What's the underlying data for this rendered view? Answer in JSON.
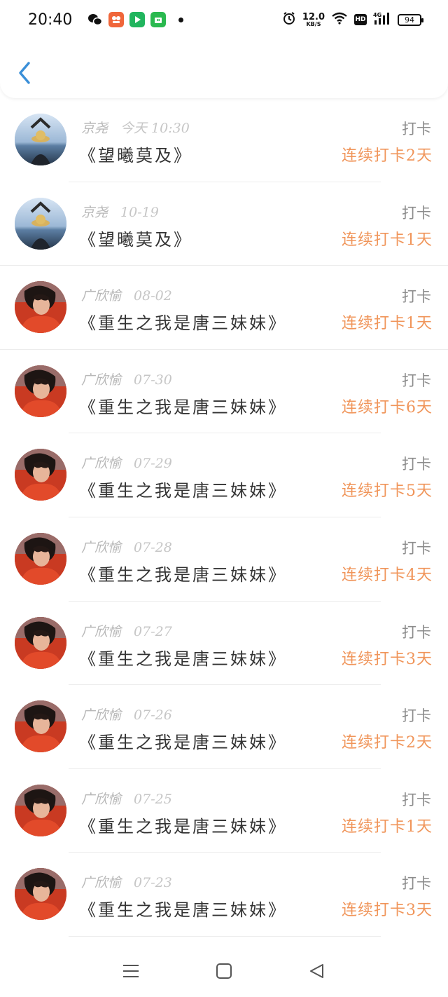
{
  "status_bar": {
    "time": "20:40",
    "net_speed": "12.0",
    "net_unit": "KB/S",
    "hd": "HD",
    "signal": "4G",
    "battery": "94"
  },
  "header": {
    "back_icon": "chevron-left-icon",
    "accent_color": "#3a8fd8"
  },
  "records": [
    {
      "user": "京尧",
      "time": "今天 10:30",
      "book": "《望曦莫及》",
      "label": "打卡",
      "streak": "连续打卡2天",
      "avatar": "sky"
    },
    {
      "user": "京尧",
      "time": "10-19",
      "book": "《望曦莫及》",
      "label": "打卡",
      "streak": "连续打卡1天",
      "avatar": "sky"
    },
    {
      "user": "广欣愉",
      "time": "08-02",
      "book": "《重生之我是唐三妹妹》",
      "label": "打卡",
      "streak": "连续打卡1天",
      "avatar": "red"
    },
    {
      "user": "广欣愉",
      "time": "07-30",
      "book": "《重生之我是唐三妹妹》",
      "label": "打卡",
      "streak": "连续打卡6天",
      "avatar": "red"
    },
    {
      "user": "广欣愉",
      "time": "07-29",
      "book": "《重生之我是唐三妹妹》",
      "label": "打卡",
      "streak": "连续打卡5天",
      "avatar": "red"
    },
    {
      "user": "广欣愉",
      "time": "07-28",
      "book": "《重生之我是唐三妹妹》",
      "label": "打卡",
      "streak": "连续打卡4天",
      "avatar": "red"
    },
    {
      "user": "广欣愉",
      "time": "07-27",
      "book": "《重生之我是唐三妹妹》",
      "label": "打卡",
      "streak": "连续打卡3天",
      "avatar": "red"
    },
    {
      "user": "广欣愉",
      "time": "07-26",
      "book": "《重生之我是唐三妹妹》",
      "label": "打卡",
      "streak": "连续打卡2天",
      "avatar": "red"
    },
    {
      "user": "广欣愉",
      "time": "07-25",
      "book": "《重生之我是唐三妹妹》",
      "label": "打卡",
      "streak": "连续打卡1天",
      "avatar": "red"
    },
    {
      "user": "广欣愉",
      "time": "07-23",
      "book": "《重生之我是唐三妹妹》",
      "label": "打卡",
      "streak": "连续打卡3天",
      "avatar": "red"
    }
  ],
  "navbar": {
    "icons": [
      "menu-icon",
      "home-square-icon",
      "back-triangle-icon"
    ]
  },
  "colors": {
    "streak": "#f0955a",
    "muted": "#b8b8b8"
  }
}
